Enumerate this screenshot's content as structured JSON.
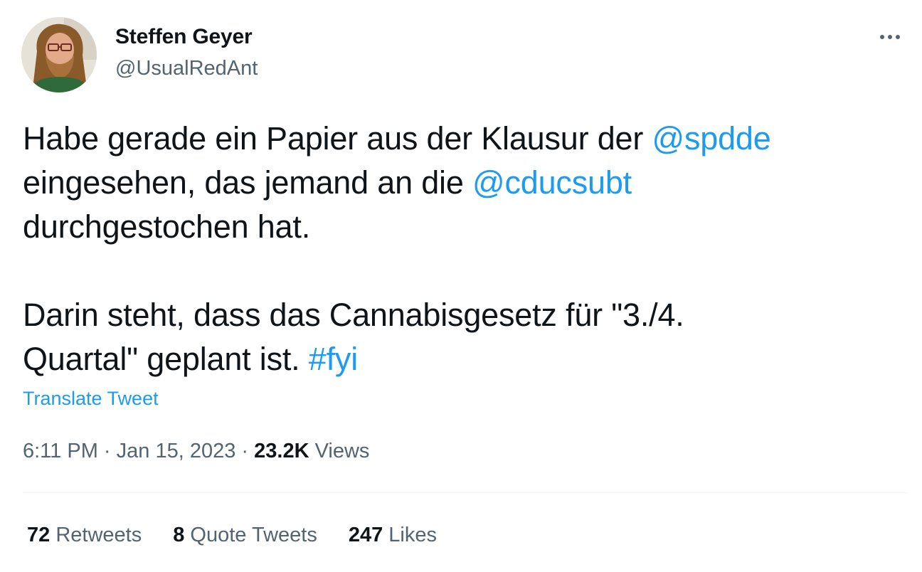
{
  "author": {
    "display_name": "Steffen Geyer",
    "handle": "@UsualRedAnt",
    "avatar_icon": "profile-photo"
  },
  "more_icon": "more-horizontal-icon",
  "tweet": {
    "line1_text": "Habe gerade ein Papier aus der Klausur der ",
    "line1_mention": "@spdde",
    "line2_text": "eingesehen, das jemand an die ",
    "line2_mention": "@cducsubt",
    "line3_text": "durchgestochen hat.",
    "line4_text": "Darin steht, dass das Cannabisgesetz für \"3./4.",
    "line5_text": "Quartal\" geplant ist. ",
    "line5_hashtag": "#fyi"
  },
  "translate_label": "Translate Tweet",
  "meta": {
    "time": "6:11 PM",
    "separator1": " · ",
    "date": "Jan 15, 2023",
    "separator2": " · ",
    "views_count": "23.2K",
    "views_label": " Views"
  },
  "stats": {
    "retweets_count": "72",
    "retweets_label": " Retweets",
    "quotes_count": "8",
    "quotes_label": " Quote Tweets",
    "likes_count": "247",
    "likes_label": " Likes"
  },
  "colors": {
    "link": "#1d9bf0",
    "text": "#0f1419",
    "secondary": "#536471",
    "divider": "#eff3f4"
  }
}
